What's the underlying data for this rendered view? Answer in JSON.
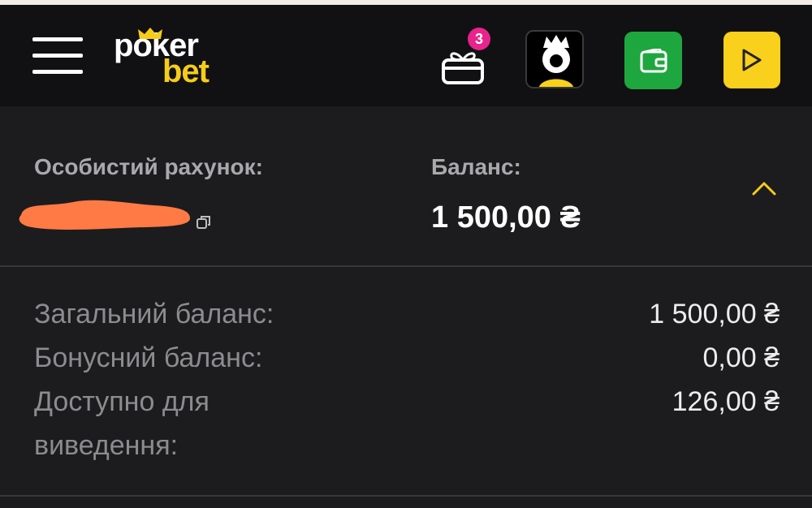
{
  "header": {
    "logo": {
      "part1": "poker",
      "part2": "bet"
    },
    "gift_badge_count": "3",
    "icons": {
      "menu": "hamburger-menu-icon",
      "gift": "gift-icon",
      "avatar": "user-avatar",
      "wallet": "wallet-icon",
      "play": "play-icon"
    },
    "colors": {
      "brand_yellow": "#f6cc1a",
      "badge_pink": "#e8248c",
      "wallet_green": "#1fa73f",
      "play_yellow": "#f9d01c"
    }
  },
  "account": {
    "account_label": "Особистий рахунок:",
    "balance_label": "Баланс:",
    "balance_value": "1 500,00 ₴"
  },
  "details": {
    "rows": [
      {
        "label": "Загальний баланс:",
        "value": "1 500,00 ₴"
      },
      {
        "label": "Бонусний баланс:",
        "value": "0,00 ₴"
      },
      {
        "label": "Доступно для виведення:",
        "value": "126,00 ₴"
      }
    ]
  }
}
